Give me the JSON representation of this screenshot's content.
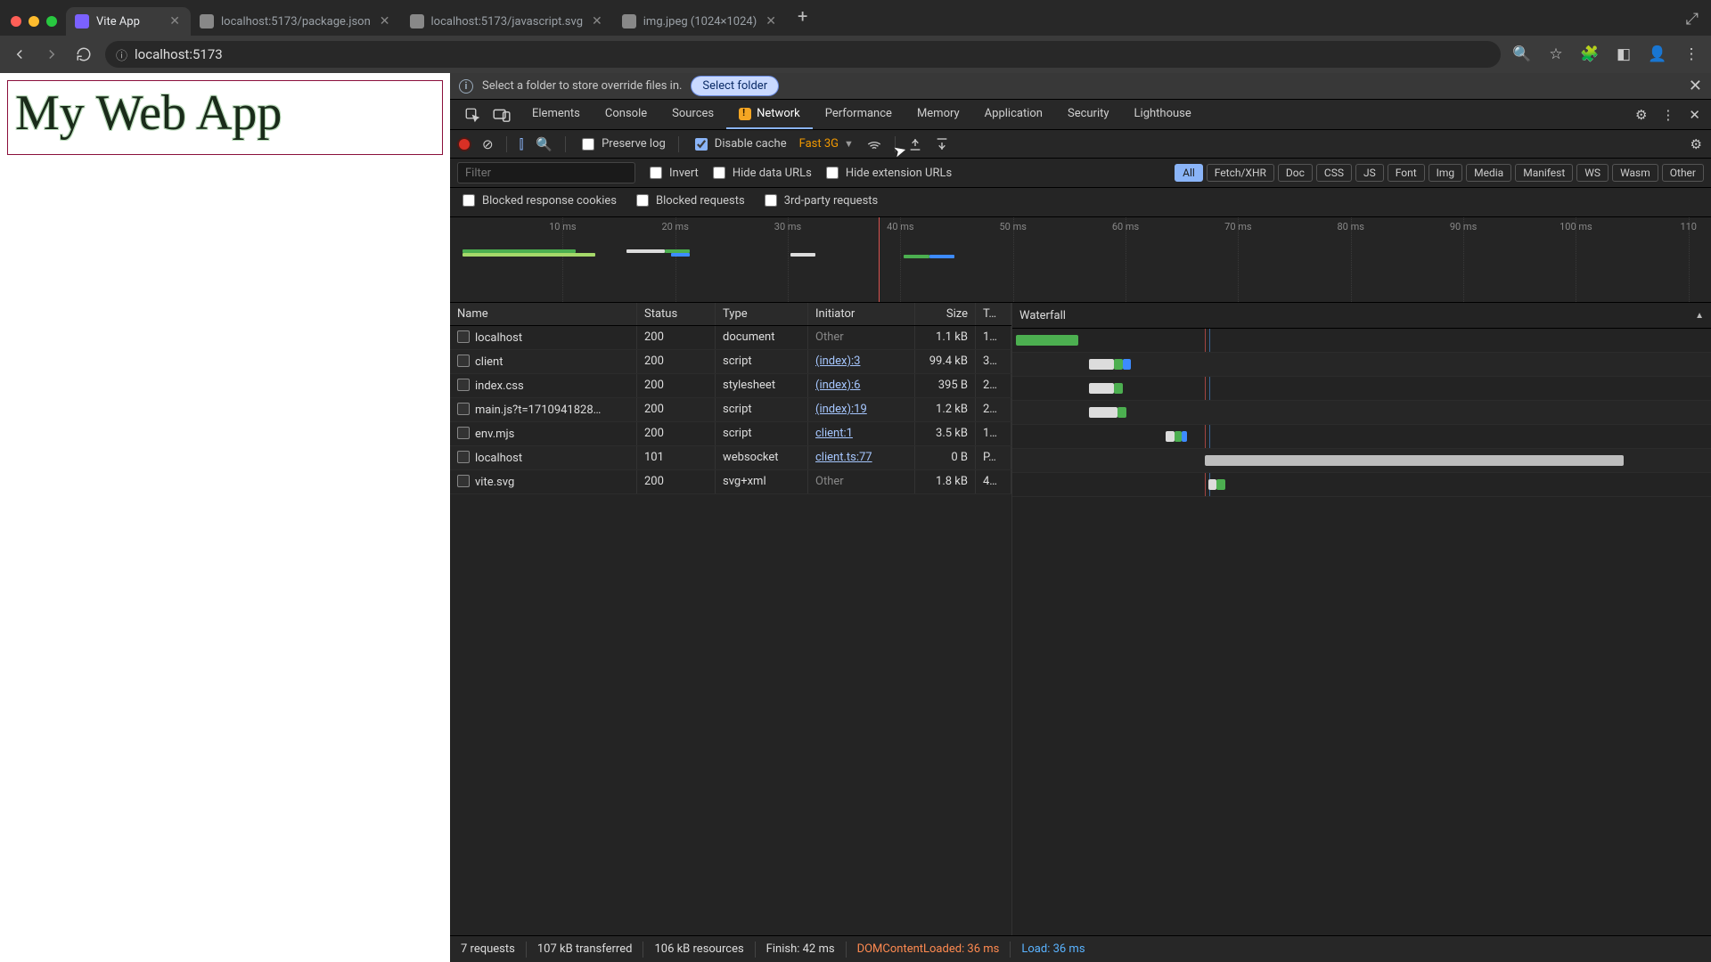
{
  "browser": {
    "traffic_colors": [
      "#ff5f57",
      "#febc2e",
      "#28c840"
    ],
    "tabs": [
      {
        "title": "Vite App",
        "active": true,
        "fav": "#7b61ff"
      },
      {
        "title": "localhost:5173/package.json",
        "active": false,
        "fav": "#888"
      },
      {
        "title": "localhost:5173/javascript.svg",
        "active": false,
        "fav": "#888"
      },
      {
        "title": "img.jpeg (1024×1024)",
        "active": false,
        "fav": "#888"
      }
    ],
    "url": "localhost:5173"
  },
  "page": {
    "heading": "My Web App"
  },
  "devtools": {
    "infobar": {
      "message": "Select a folder to store override files in.",
      "button": "Select folder"
    },
    "panels": [
      "Elements",
      "Console",
      "Sources",
      "Network",
      "Performance",
      "Memory",
      "Application",
      "Security",
      "Lighthouse"
    ],
    "active_panel": "Network",
    "toolbar": {
      "preserve_log": "Preserve log",
      "disable_cache": "Disable cache",
      "disable_cache_checked": true,
      "throttle": "Fast 3G"
    },
    "filterbar": {
      "placeholder": "Filter",
      "invert": "Invert",
      "hide_data": "Hide data URLs",
      "hide_ext": "Hide extension URLs",
      "chips": [
        "All",
        "Fetch/XHR",
        "Doc",
        "CSS",
        "JS",
        "Font",
        "Img",
        "Media",
        "Manifest",
        "WS",
        "Wasm",
        "Other"
      ],
      "blocked_cookies": "Blocked response cookies",
      "blocked_req": "Blocked requests",
      "third_party": "3rd-party requests"
    },
    "overview": {
      "ticks": [
        "10 ms",
        "20 ms",
        "30 ms",
        "40 ms",
        "50 ms",
        "60 ms",
        "70 ms",
        "80 ms",
        "90 ms",
        "100 ms",
        "110"
      ]
    },
    "table": {
      "columns": {
        "name": "Name",
        "status": "Status",
        "type": "Type",
        "initiator": "Initiator",
        "size": "Size",
        "time": "T…",
        "waterfall": "Waterfall"
      },
      "rows": [
        {
          "name": "localhost",
          "status": "200",
          "type": "document",
          "initiator": "Other",
          "initLink": false,
          "size": "1.1 kB",
          "time": "1…",
          "wf": [
            {
              "l": 0.5,
              "w": 9,
              "c": "#4caf50"
            }
          ]
        },
        {
          "name": "client",
          "status": "200",
          "type": "script",
          "initiator": "(index):3",
          "initLink": true,
          "size": "99.4 kB",
          "time": "3…",
          "wf": [
            {
              "l": 11,
              "w": 3.5,
              "c": "#dcdcdc"
            },
            {
              "l": 14.5,
              "w": 1.3,
              "c": "#4caf50"
            },
            {
              "l": 15.8,
              "w": 1.2,
              "c": "#3d8bff"
            }
          ]
        },
        {
          "name": "index.css",
          "status": "200",
          "type": "stylesheet",
          "initiator": "(index):6",
          "initLink": true,
          "size": "395 B",
          "time": "2…",
          "wf": [
            {
              "l": 11,
              "w": 3.5,
              "c": "#dcdcdc"
            },
            {
              "l": 14.5,
              "w": 1.3,
              "c": "#4caf50"
            }
          ]
        },
        {
          "name": "main.js?t=1710941828…",
          "status": "200",
          "type": "script",
          "initiator": "(index):19",
          "initLink": true,
          "size": "1.2 kB",
          "time": "2…",
          "wf": [
            {
              "l": 11,
              "w": 4,
              "c": "#dcdcdc"
            },
            {
              "l": 15,
              "w": 1.3,
              "c": "#4caf50"
            }
          ]
        },
        {
          "name": "env.mjs",
          "status": "200",
          "type": "script",
          "initiator": "client:1",
          "initLink": true,
          "size": "3.5 kB",
          "time": "1…",
          "wf": [
            {
              "l": 22,
              "w": 1.2,
              "c": "#dcdcdc"
            },
            {
              "l": 23.2,
              "w": 1,
              "c": "#4caf50"
            },
            {
              "l": 24.2,
              "w": 0.8,
              "c": "#3d8bff"
            }
          ]
        },
        {
          "name": "localhost",
          "status": "101",
          "type": "websocket",
          "initiator": "client.ts:77",
          "initLink": true,
          "size": "0 B",
          "time": "P…",
          "wf": [
            {
              "l": 27.5,
              "w": 60,
              "c": "#bdbdbd"
            }
          ]
        },
        {
          "name": "vite.svg",
          "status": "200",
          "type": "svg+xml",
          "initiator": "Other",
          "initLink": false,
          "size": "1.8 kB",
          "time": "4…",
          "wf": [
            {
              "l": 28,
              "w": 1.2,
              "c": "#dcdcdc"
            },
            {
              "l": 29.2,
              "w": 1.3,
              "c": "#4caf50"
            }
          ]
        }
      ]
    },
    "status": {
      "requests": "7 requests",
      "transferred": "107 kB transferred",
      "resources": "106 kB resources",
      "finish": "Finish: 42 ms",
      "dcl": "DOMContentLoaded: 36 ms",
      "load": "Load: 36 ms"
    }
  }
}
